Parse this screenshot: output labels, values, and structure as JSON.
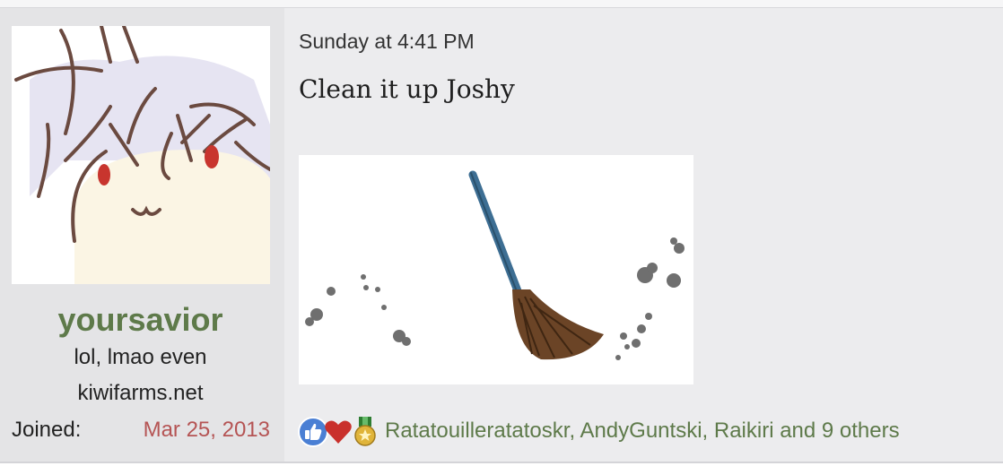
{
  "user": {
    "username": "yoursavior",
    "title": "lol, lmao even",
    "banner": "kiwifarms.net",
    "joined_label": "Joined:",
    "joined_date": "Mar 25, 2013",
    "avatar_icon": "chibi-character-avatar"
  },
  "post": {
    "timestamp": "Sunday at 4:41 PM",
    "message": "Clean it up Joshy",
    "image_icon": "broom-sweeping-image"
  },
  "reactions": {
    "icons": [
      "like-icon",
      "love-icon",
      "medal-icon"
    ],
    "users_text": "Ratatouilleratatoskr, AndyGuntski, Raikiri and 9 others"
  },
  "colors": {
    "username": "#5e7a4a",
    "joined_date": "#b55454",
    "reaction_users": "#5e7a4a",
    "post_background": "#ececee",
    "sidebar_background": "#e4e4e6"
  }
}
